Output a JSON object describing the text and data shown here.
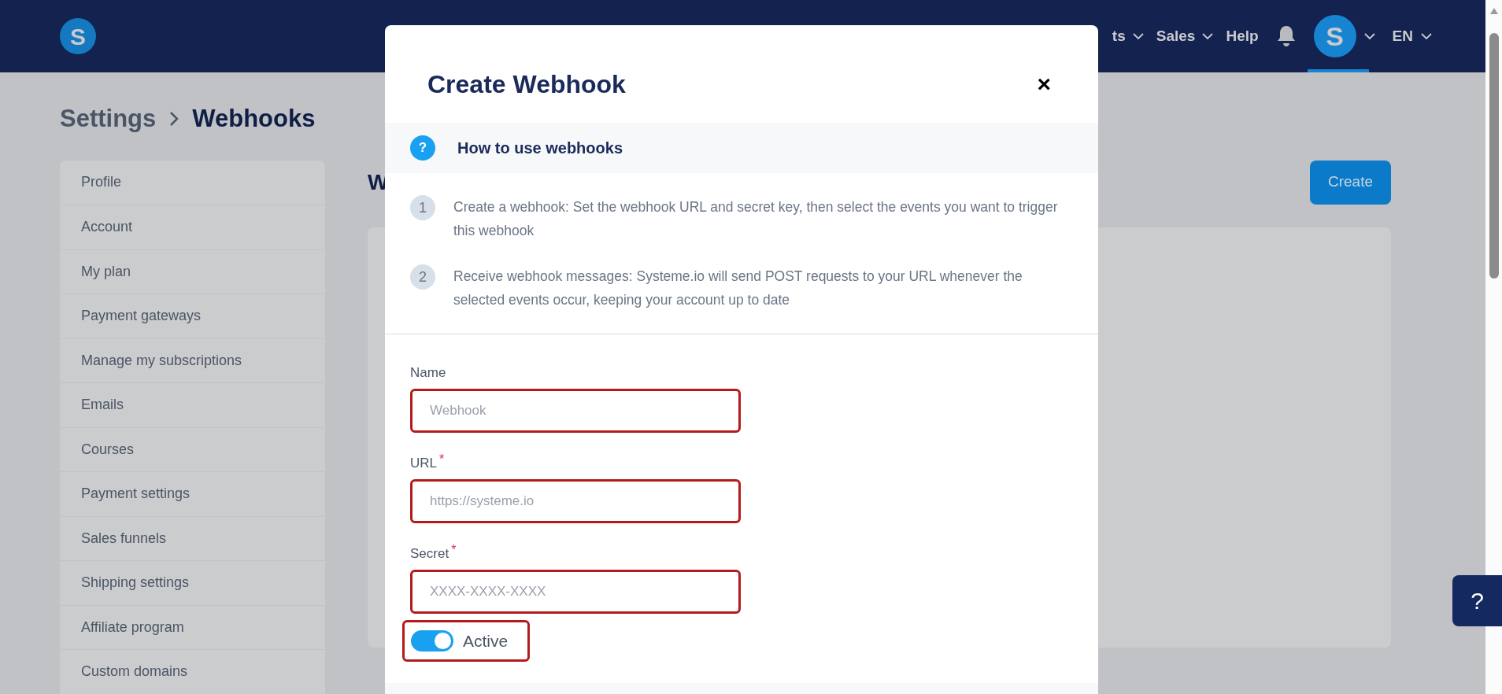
{
  "navbar": {
    "logo_letter": "S",
    "items": [
      {
        "label": "ts",
        "dropdown": true
      },
      {
        "label": "Sales",
        "dropdown": true
      },
      {
        "label": "Help",
        "dropdown": false
      }
    ],
    "avatar_letter": "S",
    "language": "EN"
  },
  "breadcrumb": {
    "parent": "Settings",
    "current": "Webhooks"
  },
  "sidebar": {
    "items": [
      {
        "label": "Profile"
      },
      {
        "label": "Account"
      },
      {
        "label": "My plan"
      },
      {
        "label": "Payment gateways"
      },
      {
        "label": "Manage my subscriptions"
      },
      {
        "label": "Emails"
      },
      {
        "label": "Courses"
      },
      {
        "label": "Payment settings"
      },
      {
        "label": "Sales funnels"
      },
      {
        "label": "Shipping settings"
      },
      {
        "label": "Affiliate program"
      },
      {
        "label": "Custom domains"
      }
    ]
  },
  "content": {
    "heading": "W",
    "create_button": "Create"
  },
  "help_button": "?",
  "modal": {
    "title": "Create Webhook",
    "close": "×",
    "info": {
      "icon": "?",
      "title": "How to use webhooks"
    },
    "steps": [
      {
        "number": "1",
        "text": "Create a webhook: Set the webhook URL and secret key, then select the events you want to trigger this webhook"
      },
      {
        "number": "2",
        "text": "Receive webhook messages: Systeme.io will send POST requests to your URL whenever the selected events occur, keeping your account up to date"
      }
    ],
    "fields": [
      {
        "label": "Name",
        "placeholder": "Webhook"
      },
      {
        "label": "URL",
        "required_mark": "*",
        "placeholder": "https://systeme.io"
      },
      {
        "label": "Secret",
        "required_mark": "*",
        "placeholder": "XXXX-XXXX-XXXX"
      }
    ],
    "toggle": {
      "label": "Active",
      "on": true
    }
  }
}
